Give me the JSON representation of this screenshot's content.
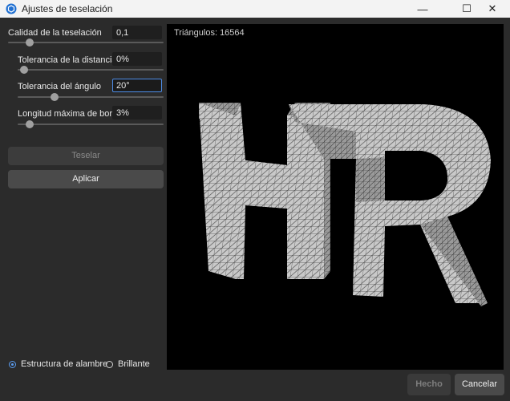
{
  "window": {
    "title": "Ajustes de teselación",
    "minimize_glyph": "—",
    "maximize_glyph": "☐",
    "close_glyph": "✕"
  },
  "settings": {
    "quality": {
      "label": "Calidad de la teselación",
      "value": "0,1",
      "slider_fraction": 0.12
    },
    "distance": {
      "label": "Tolerancia de la distancia",
      "value": "0%",
      "slider_fraction": 0.02
    },
    "angle": {
      "label": "Tolerancia del ángulo",
      "value": "20°",
      "slider_fraction": 0.24
    },
    "edge": {
      "label": "Longitud máxima de borde",
      "value": "3%",
      "slider_fraction": 0.06
    }
  },
  "buttons": {
    "tesselate": "Teselar",
    "apply": "Aplicar",
    "done": "Hecho",
    "cancel": "Cancelar"
  },
  "display_mode": {
    "options": [
      {
        "label": "Estructura de alambre",
        "checked": true
      },
      {
        "label": "Brillante",
        "checked": false
      }
    ]
  },
  "viewport": {
    "triangle_count": "Triángulos: 16564",
    "model_letters": "HR"
  },
  "colors": {
    "accent": "#4d8ce6",
    "background": "#2b2b2b",
    "viewport": "#000000"
  }
}
